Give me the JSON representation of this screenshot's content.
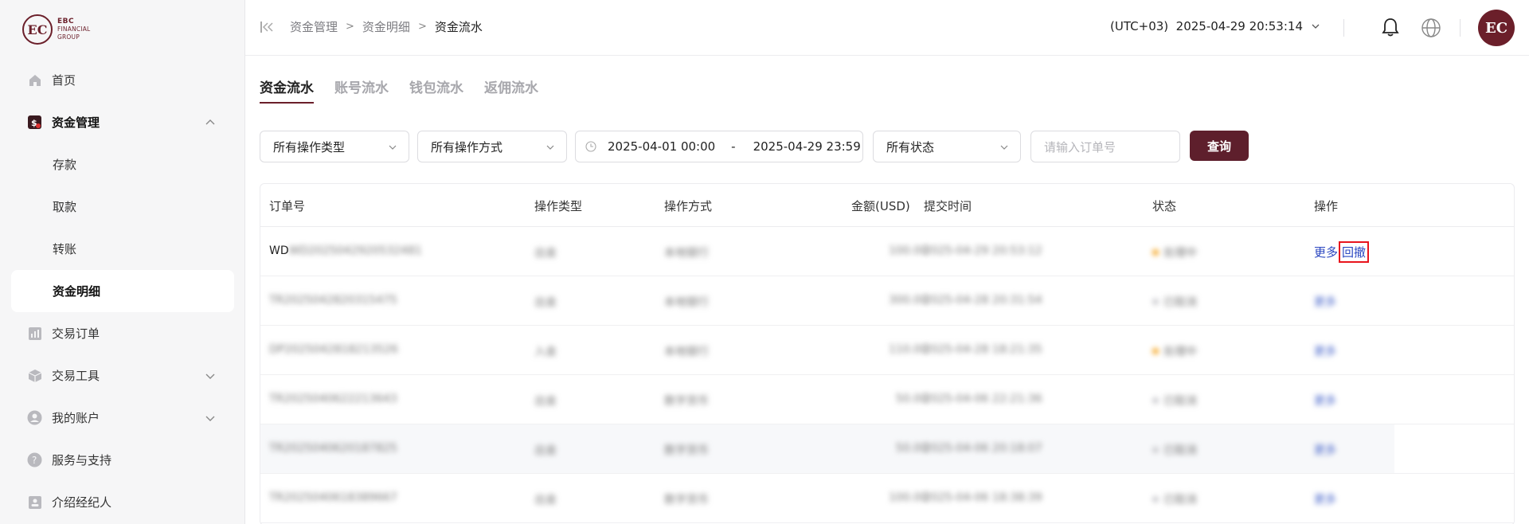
{
  "logo": {
    "mark": "EC",
    "line1": "EBC",
    "line2": "FINANCIAL",
    "line3": "GROUP"
  },
  "sidebar": {
    "items": [
      {
        "label": "首页",
        "icon": "home-icon"
      },
      {
        "label": "资金管理",
        "icon": "wallet-icon",
        "expanded": true
      },
      {
        "label": "存款"
      },
      {
        "label": "取款"
      },
      {
        "label": "转账"
      },
      {
        "label": "资金明细",
        "active": true
      },
      {
        "label": "交易订单",
        "icon": "chart-icon"
      },
      {
        "label": "交易工具",
        "icon": "box-icon"
      },
      {
        "label": "我的账户",
        "icon": "user-icon"
      },
      {
        "label": "服务与支持",
        "icon": "help-icon"
      },
      {
        "label": "介绍经纪人",
        "icon": "badge-icon"
      }
    ]
  },
  "header": {
    "breadcrumb": [
      "资金管理",
      "资金明细",
      "资金流水"
    ],
    "timezone": "(UTC+03)  2025-04-29 20:53:14",
    "avatar_text": "EC"
  },
  "tabs": [
    "资金流水",
    "账号流水",
    "钱包流水",
    "返佣流水"
  ],
  "filters": {
    "operation_type": "所有操作类型",
    "operation_method": "所有操作方式",
    "date_start": "2025-04-01 00:00",
    "date_sep": "-",
    "date_end": "2025-04-29 23:59",
    "status": "所有状态",
    "order_placeholder": "请输入订单号",
    "query_label": "查询"
  },
  "table": {
    "columns": [
      "订单号",
      "操作类型",
      "操作方式",
      "金额(USD)",
      "提交时间",
      "状态",
      "操作"
    ],
    "rows": [
      {
        "order": "WD2025042920532481",
        "type": "出金",
        "method": "本地银行",
        "amount": "100.00",
        "time": "2025-04-29 20:53:12",
        "status": "处理中",
        "status_color": "#f5a623",
        "actions": [
          "更多",
          "回撤"
        ]
      },
      {
        "order": "TR2025042820315475",
        "type": "出金",
        "method": "本地银行",
        "amount": "300.00",
        "time": "2025-04-28 20:31:54",
        "status": "已取消",
        "status_color": "#c8c8cc",
        "actions": [
          "更多"
        ]
      },
      {
        "order": "DP2025042818213526",
        "type": "入金",
        "method": "本地银行",
        "amount": "110.00",
        "time": "2025-04-28 18:21:35",
        "status": "处理中",
        "status_color": "#f5a623",
        "actions": [
          "更多"
        ]
      },
      {
        "order": "TR2025040622213643",
        "type": "出金",
        "method": "数字货币",
        "amount": "50.00",
        "time": "2025-04-06 22:21:36",
        "status": "已取消",
        "status_color": "#c8c8cc",
        "actions": [
          "更多"
        ]
      },
      {
        "order": "TR2025040620187825",
        "type": "出金",
        "method": "数字货币",
        "amount": "50.00",
        "time": "2025-04-06 20:18:07",
        "status": "已取消",
        "status_color": "#c8c8cc",
        "actions": [
          "更多"
        ]
      },
      {
        "order": "TR2025040618389667",
        "type": "出金",
        "method": "数字货币",
        "amount": "100.00",
        "time": "2025-04-06 18:38:39",
        "status": "已取消",
        "status_color": "#c8c8cc",
        "actions": [
          "更多"
        ]
      }
    ]
  },
  "colors": {
    "brand": "#6b1f2a",
    "link": "#2a46c0",
    "highlight": "#e8141d"
  }
}
